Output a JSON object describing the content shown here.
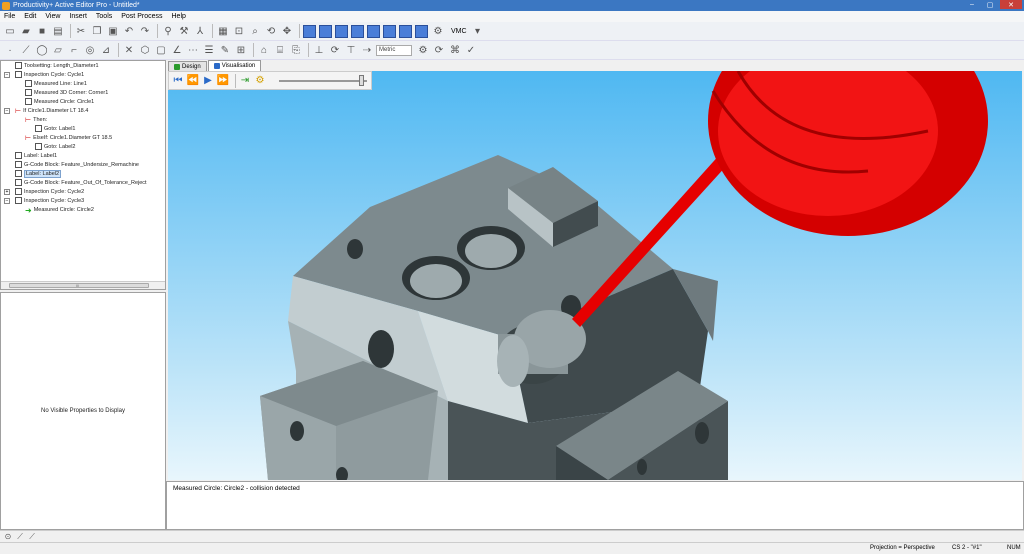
{
  "window": {
    "title": "Productivity+ Active Editor Pro - Untitled*",
    "controls": [
      "–",
      "▢",
      "✕"
    ]
  },
  "menu": [
    "File",
    "Edit",
    "View",
    "Insert",
    "Tools",
    "Post Process",
    "Help"
  ],
  "toolbar": {
    "machine_label": "VMC",
    "units_value": "Metric"
  },
  "tree": {
    "items": [
      {
        "label": "Toolsetting: Length_Diameter1"
      },
      {
        "label": "Inspection Cycle: Cycle1"
      },
      {
        "label": "Measured Line: Line1"
      },
      {
        "label": "Measured 3D Corner: Corner1"
      },
      {
        "label": "Measured Circle: Circle1"
      },
      {
        "label": "If Circle1.Diameter LT 18.4"
      },
      {
        "label": "Then:"
      },
      {
        "label": "Goto: Label1"
      },
      {
        "label": "ElseIf: Circle1.Diameter GT 18.5"
      },
      {
        "label": "Goto: Label2"
      },
      {
        "label": "Label: Label1"
      },
      {
        "label": "G-Code Block: Feature_Undersize_Remachine"
      },
      {
        "label": "Label: Label2"
      },
      {
        "label": "G-Code Block: Feature_Out_Of_Tolerance_Reject"
      },
      {
        "label": "Inspection Cycle: Cycle2"
      },
      {
        "label": "Inspection Cycle: Cycle3"
      },
      {
        "label": "Measured Circle: Circle2"
      }
    ],
    "scroll_label": "III"
  },
  "properties": {
    "empty_text": "No Visible Properties to Display"
  },
  "tabs": [
    {
      "label": "Design"
    },
    {
      "label": "Visualisation"
    }
  ],
  "message": {
    "text": "Measured Circle: Circle2 - collision detected"
  },
  "status": {
    "projection": "Projection = Perspective",
    "cs": "CS 2 - \"#1\"",
    "num": "NUM"
  },
  "colors": {
    "title_bar": "#3b77c2",
    "sky_top": "#4fb8f2",
    "part_grey": "#8a9598",
    "probe_red": "#e60000"
  }
}
